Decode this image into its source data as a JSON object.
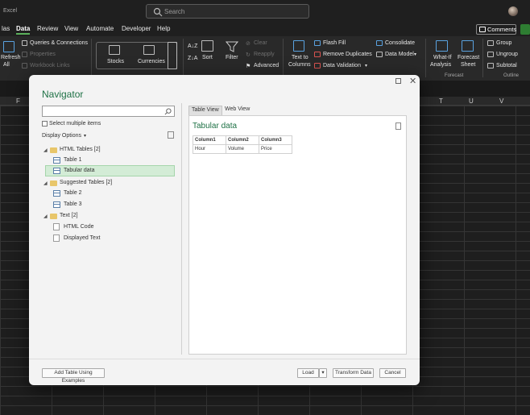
{
  "window": {
    "app_name": "Excel"
  },
  "search": {
    "placeholder": "Search"
  },
  "menu": {
    "items": [
      "las",
      "Data",
      "Review",
      "View",
      "Automate",
      "Developer",
      "Help"
    ],
    "active": "Data"
  },
  "header_buttons": {
    "comments": "Comments"
  },
  "ribbon": {
    "refresh_line1": "Refresh",
    "refresh_line2": "All",
    "queries_connections": "Queries & Connections",
    "properties": "Properties",
    "workbook_links": "Workbook Links",
    "stocks": "Stocks",
    "currencies": "Currencies",
    "sort": "Sort",
    "filter": "Filter",
    "clear": "Clear",
    "reapply": "Reapply",
    "advanced": "Advanced",
    "text_to_columns_line1": "Text to",
    "text_to_columns_line2": "Columns",
    "flash_fill": "Flash Fill",
    "remove_duplicates": "Remove Duplicates",
    "data_validation": "Data Validation",
    "consolidate": "Consolidate",
    "data_model": "Data Model",
    "what_if_line1": "What-If",
    "what_if_line2": "Analysis",
    "forecast_sheet_line1": "Forecast",
    "forecast_sheet_line2": "Sheet",
    "forecast_group": "Forecast",
    "group": "Group",
    "ungroup": "Ungroup",
    "subtotal": "Subtotal",
    "outline_group": "Outline"
  },
  "sheet": {
    "column_letters": [
      "F",
      "T",
      "U",
      "V"
    ]
  },
  "navigator": {
    "title": "Navigator",
    "search_value": "",
    "select_multiple": "Select multiple items",
    "display_options": "Display Options",
    "tree": [
      {
        "label": "HTML Tables [2]",
        "children": [
          "Table 1",
          "Tabular data"
        ]
      },
      {
        "label": "Suggested Tables [2]",
        "children": [
          "Table 2",
          "Table 3"
        ]
      },
      {
        "label": "Text [2]",
        "children": [
          "HTML Code",
          "Displayed Text"
        ]
      }
    ],
    "selected_item": "Tabular data",
    "tabs": [
      "Table View",
      "Web View"
    ],
    "active_tab": "Table View",
    "preview": {
      "title": "Tabular data",
      "headers": [
        "Column1",
        "Column2",
        "Column3"
      ],
      "rows": [
        [
          "Hour",
          "Volume",
          "Price"
        ]
      ]
    },
    "buttons": {
      "add_table": "Add Table Using Examples",
      "load": "Load",
      "transform": "Transform Data",
      "cancel": "Cancel"
    }
  },
  "colors": {
    "accent_green": "#1e7145",
    "selection": "#d3ecd6",
    "ribbon_bg": "#292929"
  }
}
